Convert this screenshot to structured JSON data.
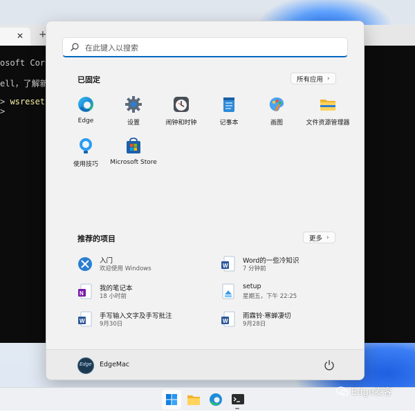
{
  "terminal": {
    "lines": [
      "osoft Corpo",
      "ell，了解新",
      "> ",
      ">"
    ],
    "command": "wsreset"
  },
  "start_menu": {
    "search": {
      "placeholder": "在此键入以搜索"
    },
    "pinned": {
      "title": "已固定",
      "all_apps_label": "所有应用",
      "apps": [
        {
          "label": "Edge",
          "icon": "edge-icon"
        },
        {
          "label": "设置",
          "icon": "gear-icon"
        },
        {
          "label": "闹钟和时钟",
          "icon": "clock-icon"
        },
        {
          "label": "记事本",
          "icon": "notepad-icon"
        },
        {
          "label": "画图",
          "icon": "paint-icon"
        },
        {
          "label": "文件资源管理器",
          "icon": "folder-icon"
        },
        {
          "label": "使用技巧",
          "icon": "tips-icon"
        },
        {
          "label": "Microsoft Store",
          "icon": "store-icon"
        }
      ]
    },
    "recommended": {
      "title": "推荐的项目",
      "more_label": "更多",
      "items": [
        {
          "title": "入门",
          "subtitle": "欢迎使用 Windows",
          "icon": "get-started-icon"
        },
        {
          "title": "Word的一些冷知识",
          "subtitle": "7 分钟前",
          "icon": "word-doc-icon"
        },
        {
          "title": "我的笔记本",
          "subtitle": "18 小时前",
          "icon": "onenote-icon"
        },
        {
          "title": "setup",
          "subtitle": "星期五，下午 22:25",
          "icon": "setup-file-icon"
        },
        {
          "title": "手写输入文字及手写批注",
          "subtitle": "9月30日",
          "icon": "word-doc-icon"
        },
        {
          "title": "雨霖铃·寒蝉凄切",
          "subtitle": "9月28日",
          "icon": "word-doc-icon"
        }
      ]
    },
    "user": {
      "name": "EdgeMac",
      "avatar_text": "Edge"
    }
  },
  "taskbar": {
    "items": [
      "start-icon",
      "file-explorer-icon",
      "edge-icon",
      "terminal-icon"
    ]
  },
  "watermark": {
    "text": "Edge麦客"
  },
  "colors": {
    "accent": "#0067c0",
    "terminal_bg": "#0c0c0c",
    "menu_bg": "#f2f2f2"
  }
}
